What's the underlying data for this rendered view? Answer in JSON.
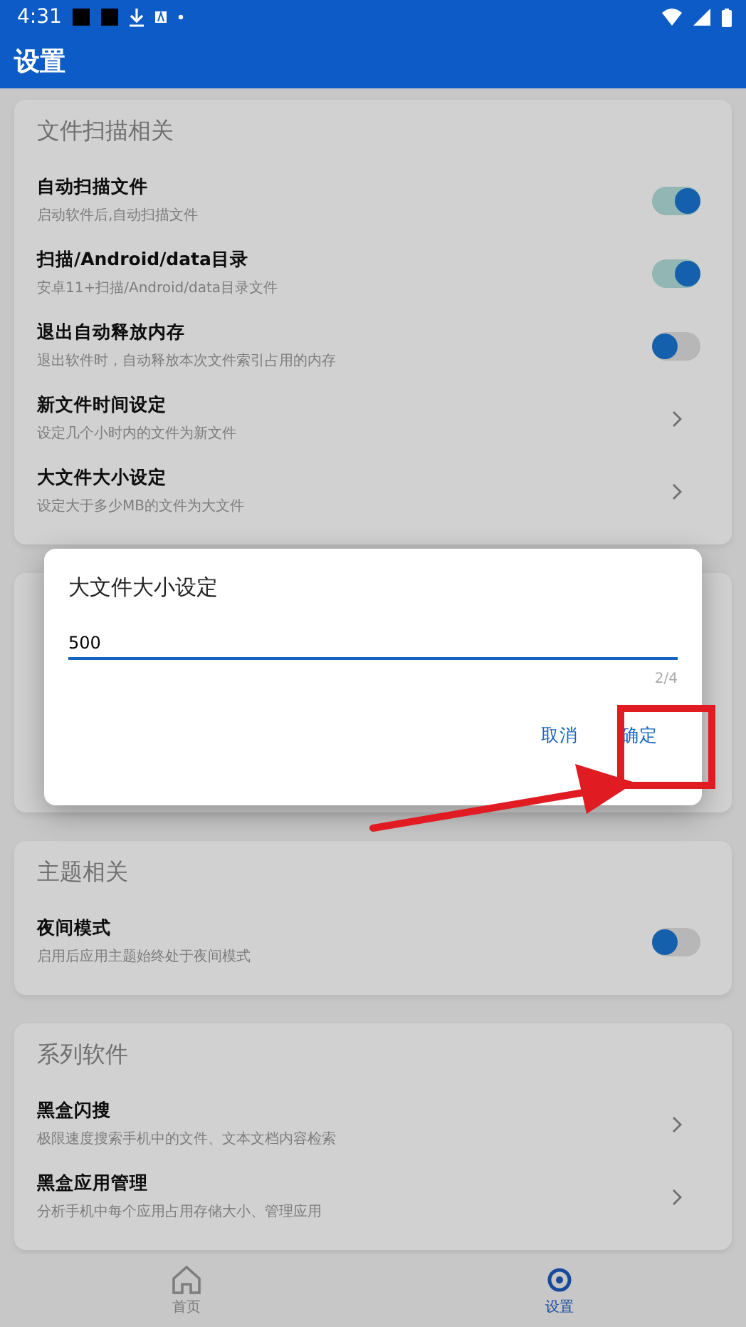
{
  "status_bar": {
    "time": "4:31"
  },
  "app_bar": {
    "title": "设置"
  },
  "sections": [
    {
      "title": "文件扫描相关",
      "items": [
        {
          "kind": "switch",
          "title": "自动扫描文件",
          "subtitle": "启动软件后,自动扫描文件",
          "on": true
        },
        {
          "kind": "switch",
          "title": "扫描/Android/data目录",
          "subtitle": "安卓11+扫描/Android/data目录文件",
          "on": true
        },
        {
          "kind": "switch",
          "title": "退出自动释放内存",
          "subtitle": "退出软件时，自动释放本次文件索引占用的内存",
          "on": false
        },
        {
          "kind": "link",
          "title": "新文件时间设定",
          "subtitle": "设定几个小时内的文件为新文件"
        },
        {
          "kind": "link",
          "title": "大文件大小设定",
          "subtitle": "设定大于多少MB的文件为大文件"
        }
      ]
    },
    {
      "kind": "hidden"
    },
    {
      "title": "主题相关",
      "items": [
        {
          "kind": "switch",
          "title": "夜间模式",
          "subtitle": "启用后应用主题始终处于夜间模式",
          "on": false
        }
      ]
    },
    {
      "title": "系列软件",
      "items": [
        {
          "kind": "link",
          "title": "黑盒闪搜",
          "subtitle": "极限速度搜索手机中的文件、文本文档内容检索"
        },
        {
          "kind": "link",
          "title": "黑盒应用管理",
          "subtitle": "分析手机中每个应用占用存储大小、管理应用"
        }
      ]
    }
  ],
  "bottom_nav": [
    {
      "label": "首页",
      "selected": false
    },
    {
      "label": "设置",
      "selected": true
    }
  ],
  "dialog": {
    "title": "大文件大小设定",
    "value": "500",
    "counter": "2/4",
    "buttons": [
      "取消",
      "确定"
    ]
  }
}
